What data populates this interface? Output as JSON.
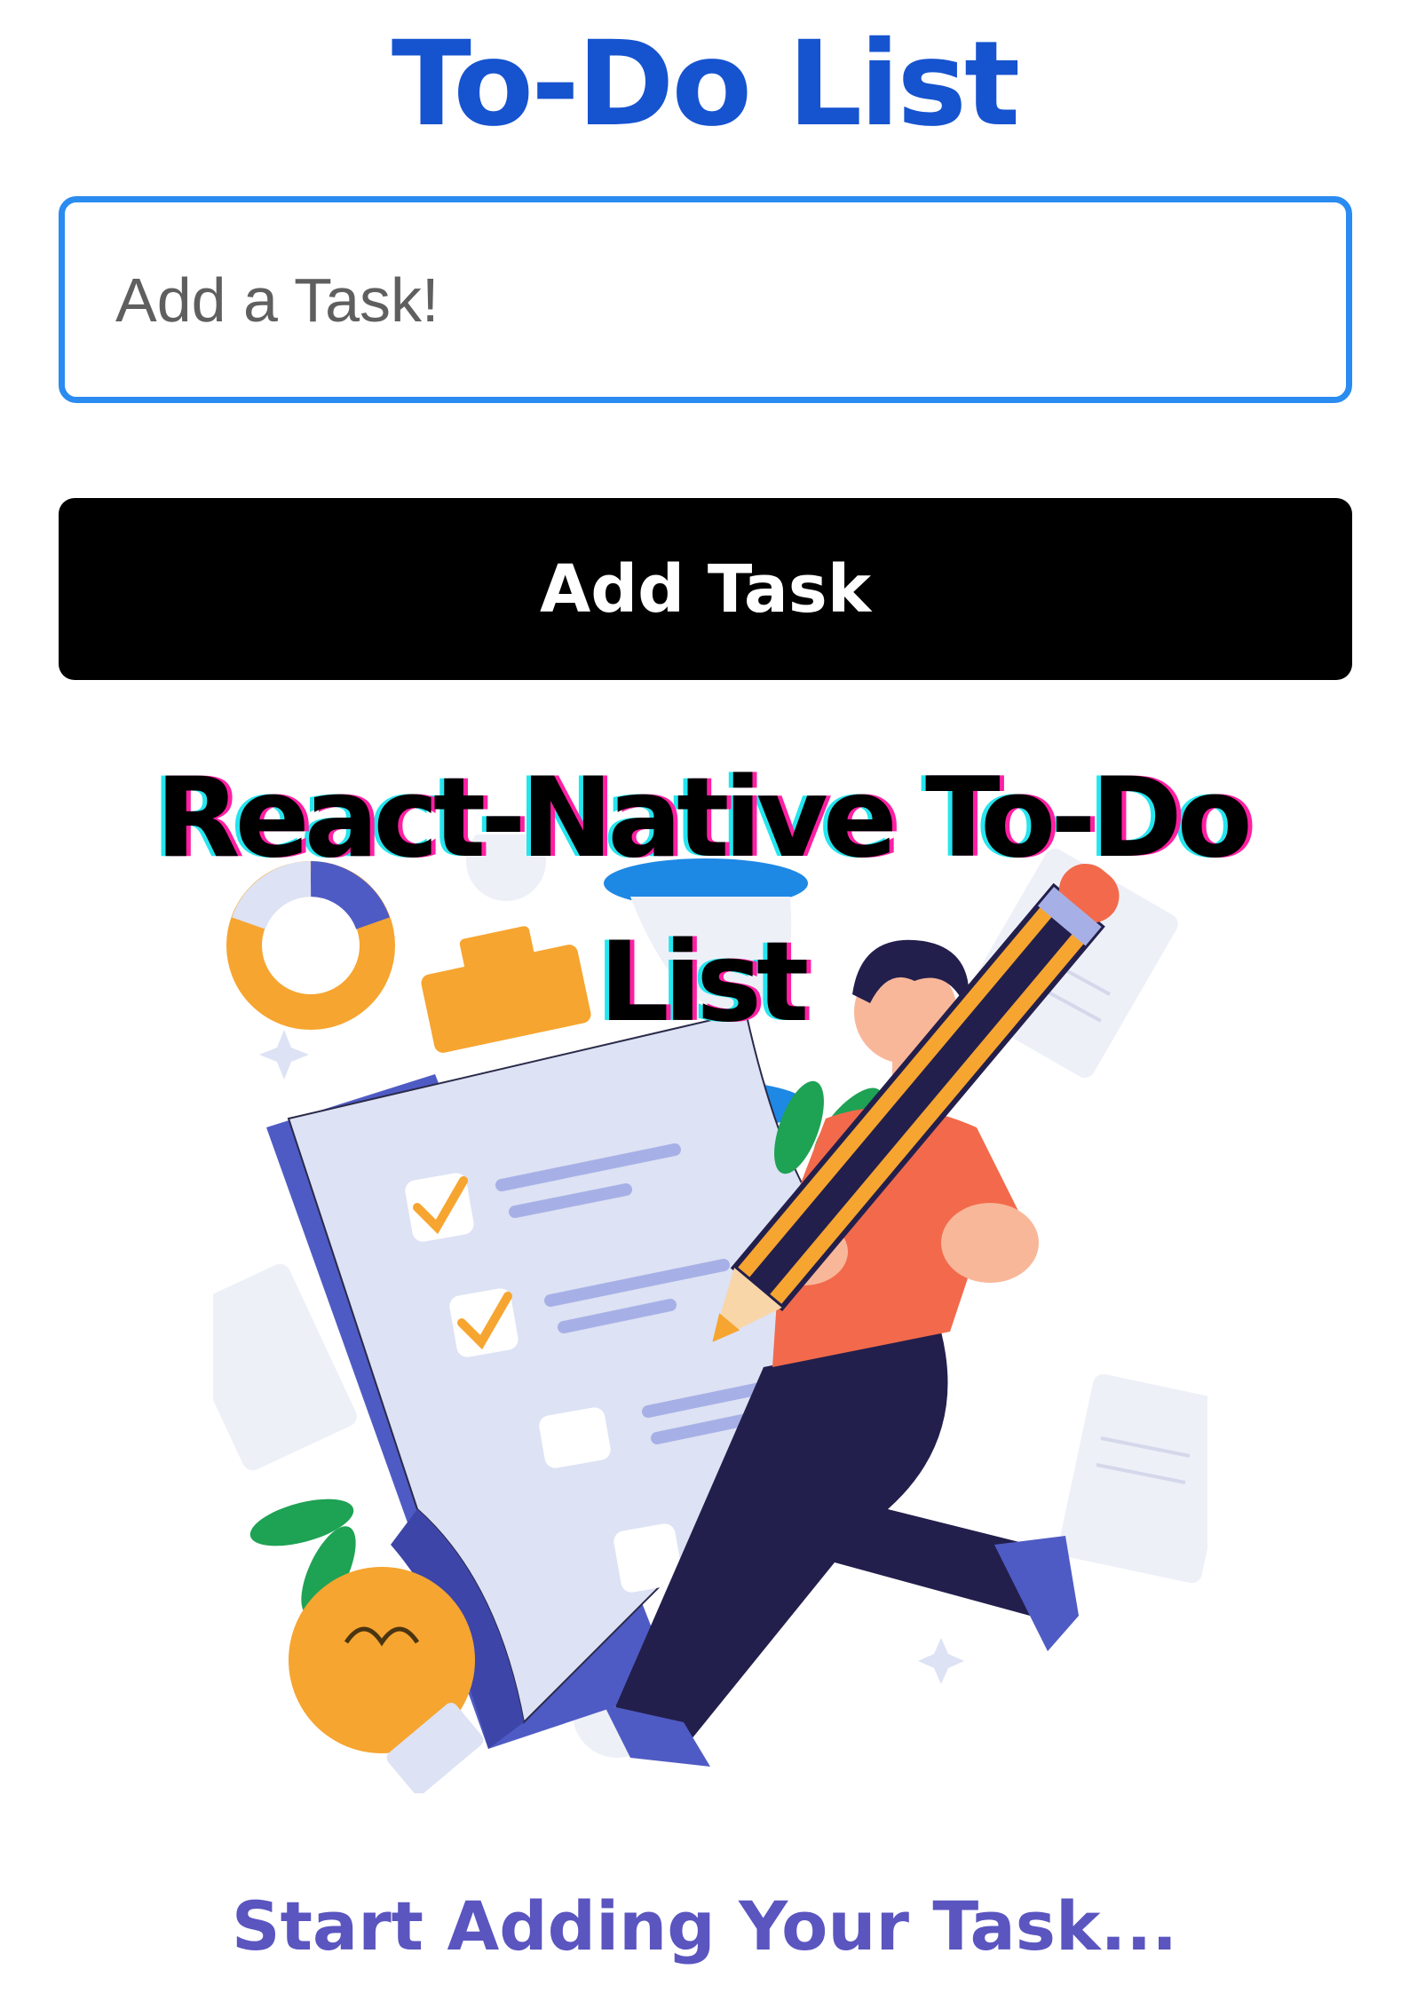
{
  "header": {
    "title": "To-Do List"
  },
  "task_input": {
    "placeholder": "Add a Task!",
    "value": ""
  },
  "add_button": {
    "label": "Add Task"
  },
  "banner": {
    "title": "React-Native To-Do List"
  },
  "illustration": {
    "icon": "clipboard-checklist-illustration",
    "colors": {
      "clipboard_back": "#4f5bc4",
      "paper": "#dde2f4",
      "clip": "#f6a530",
      "check": "#f6a530",
      "shirt": "#f26a4b",
      "pants": "#231f4c",
      "pencil": "#f6a530",
      "leaf": "#1ea254",
      "bulb": "#f6a530"
    }
  },
  "empty_state": {
    "message": "Start Adding Your Task..."
  },
  "colors": {
    "title": "#1653cf",
    "input_border": "#2a8bf0",
    "button_bg": "#000000",
    "button_text": "#ffffff",
    "empty_message": "#5a55bf"
  }
}
